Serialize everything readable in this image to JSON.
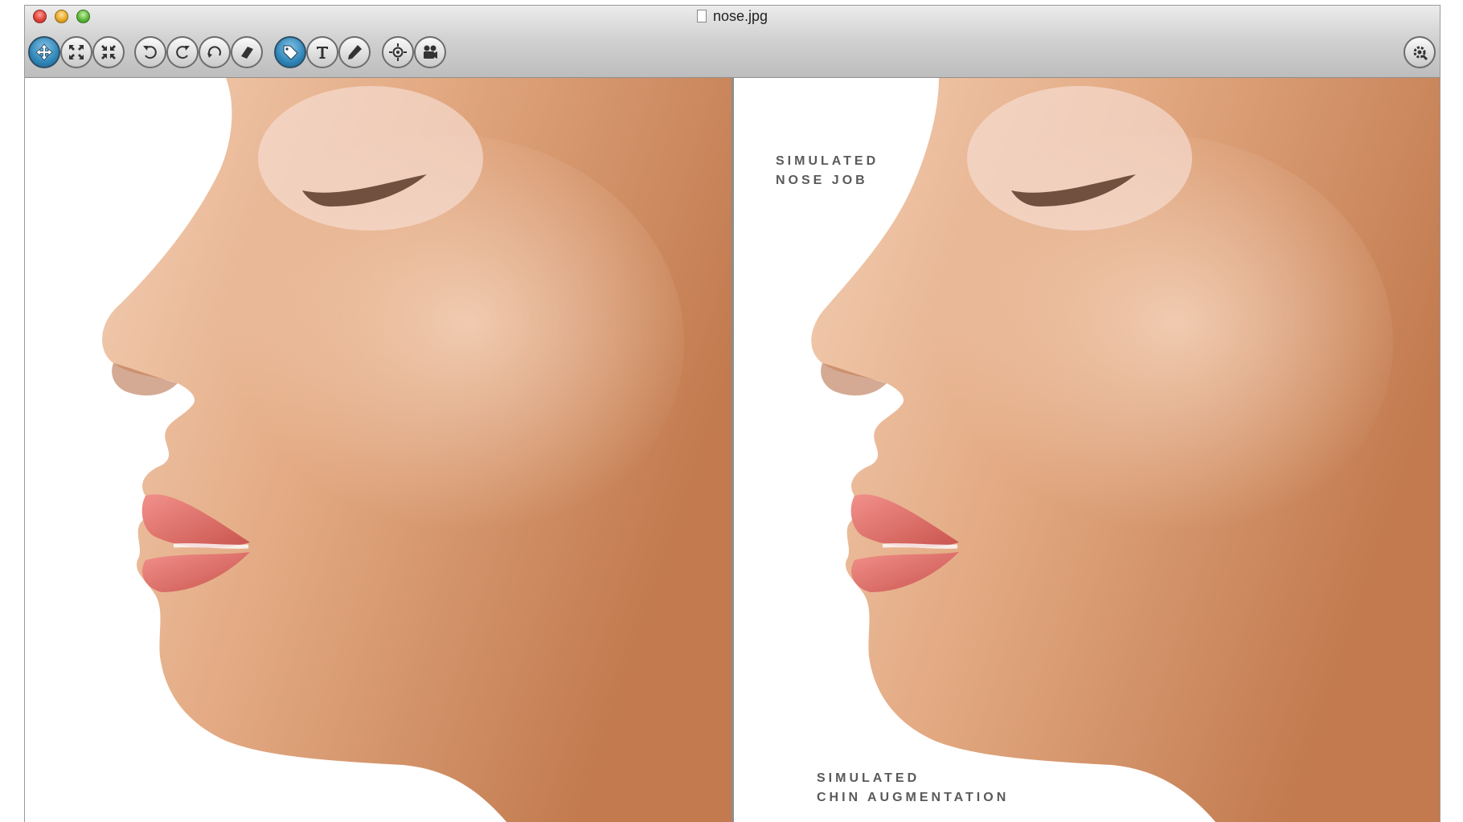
{
  "window": {
    "title": "nose.jpg"
  },
  "toolbar": {
    "buttons": [
      {
        "icon": "move-icon",
        "active": true
      },
      {
        "icon": "zoom-fit-icon",
        "active": false
      },
      {
        "icon": "zoom-actual-icon",
        "active": false
      },
      {
        "icon": "rotate-left-icon",
        "active": false
      },
      {
        "icon": "rotate-right-icon",
        "active": false
      },
      {
        "icon": "rotate-free-icon",
        "active": false
      },
      {
        "icon": "eraser-icon",
        "active": false
      },
      {
        "icon": "tag-icon",
        "active": true
      },
      {
        "icon": "text-icon",
        "active": false
      },
      {
        "icon": "pen-icon",
        "active": false
      },
      {
        "icon": "target-icon",
        "active": false
      },
      {
        "icon": "camera-icon",
        "active": false
      },
      {
        "icon": "settings-icon",
        "active": false
      }
    ]
  },
  "annotations": {
    "nose_line1": "SIMULATED",
    "nose_line2": "NOSE JOB",
    "chin_line1": "SIMULATED",
    "chin_line2": "CHIN AUGMENTATION"
  }
}
